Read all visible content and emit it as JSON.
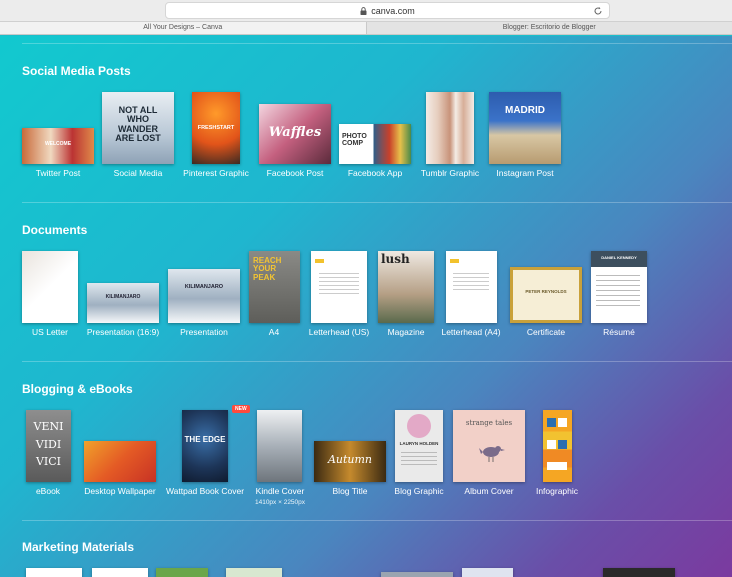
{
  "browser": {
    "url": "canva.com",
    "tabs": [
      "All Your Designs – Canva",
      "Blogger: Escritorio de Blogger"
    ]
  },
  "sections": [
    {
      "title": "Social Media Posts",
      "items": [
        {
          "label": "Twitter Post",
          "thumb_text": "WELCOME"
        },
        {
          "label": "Social Media",
          "thumb_text": "NOT ALL WHO WANDER ARE LOST"
        },
        {
          "label": "Pinterest Graphic",
          "thumb_text": "FRESHSTART"
        },
        {
          "label": "Facebook Post",
          "thumb_text": "Waffles"
        },
        {
          "label": "Facebook App",
          "thumb_text": "PHOTO COMP"
        },
        {
          "label": "Tumblr Graphic",
          "thumb_text": ""
        },
        {
          "label": "Instagram Post",
          "thumb_text": "MADRID"
        }
      ]
    },
    {
      "title": "Documents",
      "items": [
        {
          "label": "US Letter",
          "thumb_text": ""
        },
        {
          "label": "Presentation (16:9)",
          "thumb_text": "KILIMANJARO"
        },
        {
          "label": "Presentation",
          "thumb_text": "KILIMANJARO"
        },
        {
          "label": "A4",
          "thumb_text": "REACH YOUR PEAK"
        },
        {
          "label": "Letterhead (US)",
          "thumb_text": ""
        },
        {
          "label": "Magazine",
          "thumb_text": "lush"
        },
        {
          "label": "Letterhead (A4)",
          "thumb_text": ""
        },
        {
          "label": "Certificate",
          "thumb_text": "PETER REYNOLDS"
        },
        {
          "label": "Résumé",
          "thumb_text": "DANIEL KENNEDY"
        }
      ]
    },
    {
      "title": "Blogging & eBooks",
      "items": [
        {
          "label": "eBook",
          "thumb_text": "VENI VIDI VICI"
        },
        {
          "label": "Desktop Wallpaper",
          "thumb_text": ""
        },
        {
          "label": "Wattpad Book Cover",
          "thumb_text": "THE EDGE",
          "badge": "NEW"
        },
        {
          "label": "Kindle Cover",
          "sublabel": "1410px × 2250px",
          "thumb_text": ""
        },
        {
          "label": "Blog Title",
          "thumb_text": "Autumn"
        },
        {
          "label": "Blog Graphic",
          "thumb_text": "LAURYN HOLDEN"
        },
        {
          "label": "Album Cover",
          "thumb_text": "strange tales"
        },
        {
          "label": "Infographic",
          "thumb_text": ""
        }
      ]
    },
    {
      "title": "Marketing Materials",
      "items": []
    }
  ],
  "colors": {
    "gradient_start": "#12c9cf",
    "gradient_end": "#7b3a9f",
    "badge": "#ff4b3e"
  }
}
